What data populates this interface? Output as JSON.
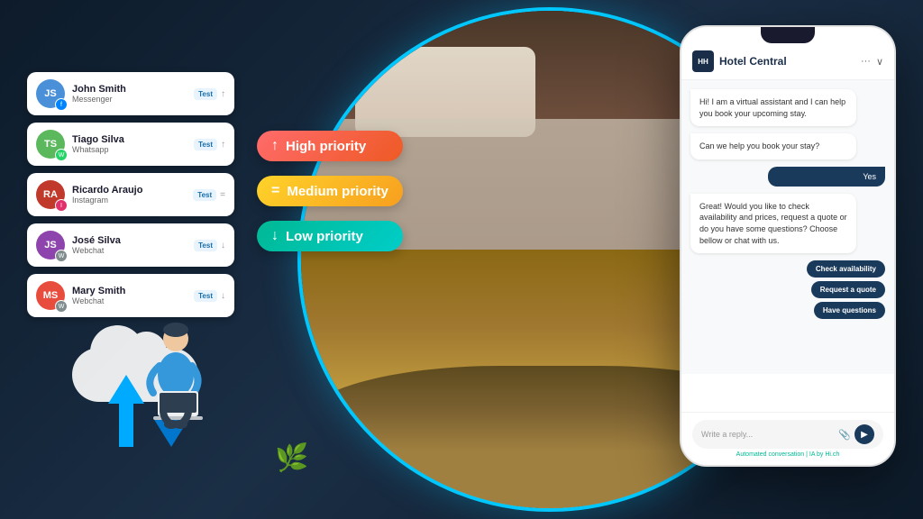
{
  "background": {
    "color": "#0d1b2a"
  },
  "chat_list": {
    "items": [
      {
        "name": "John Smith",
        "platform": "Messenger",
        "platform_color": "#0084ff",
        "avatar_color": "#4a90d9",
        "avatar_initials": "JS",
        "tag": "Test",
        "icon": "↑"
      },
      {
        "name": "Tiago Silva",
        "platform": "Whatsapp",
        "platform_color": "#25d366",
        "avatar_color": "#5cb85c",
        "avatar_initials": "TS",
        "tag": "Test",
        "icon": "↑"
      },
      {
        "name": "Ricardo Araujo",
        "platform": "Instagram",
        "platform_color": "#e1306c",
        "avatar_color": "#c0392b",
        "avatar_initials": "RA",
        "tag": "Test",
        "icon": "="
      },
      {
        "name": "José Silva",
        "platform": "Webchat",
        "platform_color": "#7f8c8d",
        "avatar_color": "#8e44ad",
        "avatar_initials": "JS",
        "tag": "Test",
        "icon": "↓"
      },
      {
        "name": "Mary Smith",
        "platform": "Webchat",
        "platform_color": "#7f8c8d",
        "avatar_color": "#e74c3c",
        "avatar_initials": "MS",
        "tag": "Test",
        "icon": "↓"
      }
    ]
  },
  "priorities": {
    "high": {
      "label": "High priority",
      "icon": "↑",
      "bg": "linear-gradient(135deg, #ff6b6b, #ee5a24)"
    },
    "medium": {
      "label": "Medium priority",
      "icon": "=",
      "bg": "linear-gradient(135deg, #ffd32a, #f79f1f)"
    },
    "low": {
      "label": "Low priority",
      "icon": "↓",
      "bg": "linear-gradient(135deg, #00b894, #00cec9)"
    }
  },
  "phone": {
    "hotel_name": "Hotel Central",
    "header_icons": [
      "···",
      "∨"
    ],
    "messages": [
      {
        "type": "bot",
        "text": "Hi! I am a virtual assistant and I can help you book your upcoming stay."
      },
      {
        "type": "bot",
        "text": "Can we help you book your stay?"
      },
      {
        "type": "user",
        "text": "Yes"
      },
      {
        "type": "bot",
        "text": "Great! Would you like to check availability and prices, request a quote or do you have some questions? Choose bellow or chat with us."
      }
    ],
    "quick_actions": [
      "Check availability",
      "Request a quote",
      "Have questions"
    ],
    "reply_placeholder": "Write a reply...",
    "automated_tag": "Automated conversation | IA by Hi.ch"
  }
}
